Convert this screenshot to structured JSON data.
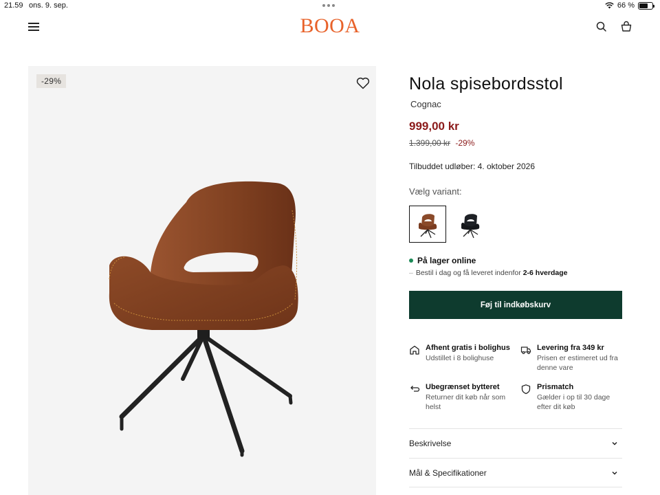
{
  "status_bar": {
    "time": "21.59",
    "date": "ons. 9. sep.",
    "battery": "66 %",
    "battery_level": 0.66
  },
  "header": {
    "logo": "BOOA",
    "brand_color": "#e8622a",
    "icons": [
      "menu-icon",
      "search-icon",
      "cart-icon"
    ]
  },
  "gallery": {
    "badge": "-29%",
    "favorite_icon": "heart-icon"
  },
  "product": {
    "title": "Nola spisebordsstol",
    "variant_name": "Cognac",
    "price": "999,00 kr",
    "old_price": "1.399,00 kr",
    "discount": "-29%",
    "offer_expiry": "Tilbuddet udløber: 4. oktober 2026",
    "variant_label": "Vælg variant:",
    "variants": [
      {
        "name": "cognac",
        "color": "#8a4a2a",
        "selected": true
      },
      {
        "name": "black",
        "color": "#1e2126",
        "selected": false
      }
    ],
    "stock_status": "På lager online",
    "delivery_prefix": "Bestil i dag og få leveret indenfor ",
    "delivery_days": "2-6 hverdage",
    "add_to_cart": "Føj til indkøbskurv",
    "price_color": "#8b1a1a",
    "cart_button_color": "#0e3b2e"
  },
  "usps": [
    {
      "icon": "store-icon",
      "title": "Afhent gratis i bolighus",
      "desc": "Udstillet i 8 bolighuse"
    },
    {
      "icon": "truck-icon",
      "title": "Levering fra 349 kr",
      "desc": "Prisen er estimeret ud fra denne vare"
    },
    {
      "icon": "return-icon",
      "title": "Ubegrænset bytteret",
      "desc": "Returner dit køb når som helst"
    },
    {
      "icon": "shield-icon",
      "title": "Prismatch",
      "desc": "Gælder i op til 30 dage efter dit køb"
    }
  ],
  "accordion": [
    {
      "label": "Beskrivelse"
    },
    {
      "label": "Mål & Specifikationer"
    }
  ]
}
